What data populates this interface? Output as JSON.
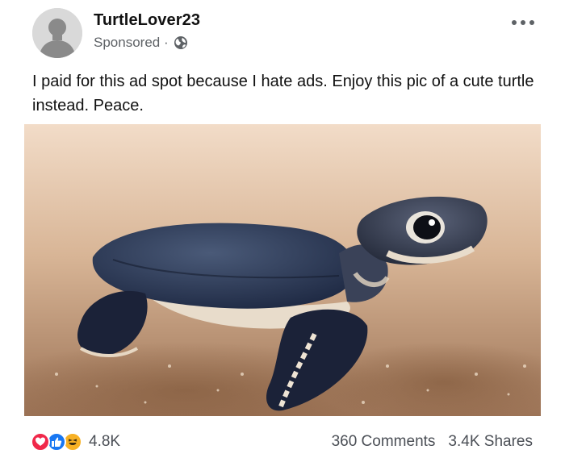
{
  "post": {
    "author": "TurtleLover23",
    "sponsored_label": "Sponsored ·",
    "caption": "I paid for this ad spot because I hate ads. Enjoy this pic of a cute turtle instead. Peace.",
    "icons": {
      "avatar": "default-avatar-icon",
      "globe": "globe-icon",
      "more": "more-options-icon",
      "reactions": [
        "love-icon",
        "like-icon",
        "haha-icon"
      ]
    },
    "colors": {
      "love": "#f0284a",
      "like": "#1877f2",
      "haha": "#f7b125",
      "secondary_text": "#5e6266"
    }
  },
  "footer": {
    "reaction_count": "4.8K",
    "comments": "360 Comments",
    "shares": "3.4K Shares"
  }
}
